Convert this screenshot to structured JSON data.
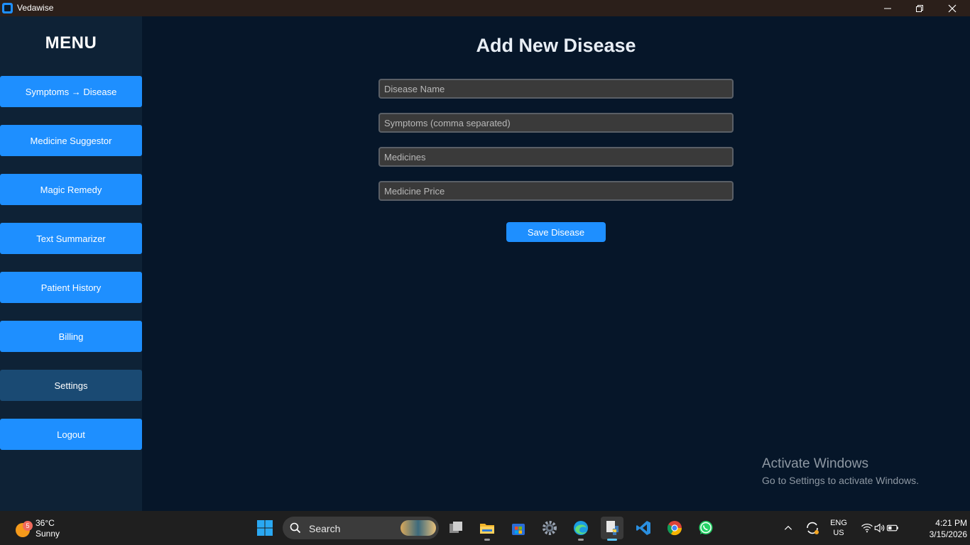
{
  "window": {
    "title": "Vedawise"
  },
  "sidebar": {
    "heading": "MENU",
    "items": [
      {
        "label": "Symptoms → Disease"
      },
      {
        "label": "Medicine Suggestor"
      },
      {
        "label": "Magic Remedy"
      },
      {
        "label": "Text Summarizer"
      },
      {
        "label": "Patient History"
      },
      {
        "label": "Billing"
      },
      {
        "label": "Settings",
        "active": true
      },
      {
        "label": "Logout"
      }
    ]
  },
  "form": {
    "title": "Add New Disease",
    "fields": [
      {
        "placeholder": "Disease Name",
        "value": ""
      },
      {
        "placeholder": "Symptoms (comma separated)",
        "value": ""
      },
      {
        "placeholder": "Medicines",
        "value": ""
      },
      {
        "placeholder": "Medicine Price",
        "value": ""
      }
    ],
    "save_label": "Save Disease"
  },
  "watermark": {
    "title": "Activate Windows",
    "subtitle": "Go to Settings to activate Windows."
  },
  "taskbar": {
    "weather": {
      "temp": "36°C",
      "condition": "Sunny",
      "badge": "5"
    },
    "search_label": "Search",
    "language": {
      "line1": "ENG",
      "line2": "US"
    },
    "time": "4:21 PM",
    "date": "3/15/2026",
    "icons": [
      "windows-start-icon",
      "search-icon",
      "task-view-icon",
      "file-explorer-icon",
      "microsoft-store-icon",
      "settings-gear-icon",
      "edge-browser-icon",
      "python-app-icon",
      "vscode-icon",
      "chrome-icon",
      "whatsapp-icon"
    ]
  },
  "colors": {
    "accent": "#1e8fff",
    "active_item": "#1a4a73",
    "sidebar_bg": "#0e2236",
    "main_bg": "#061629"
  }
}
